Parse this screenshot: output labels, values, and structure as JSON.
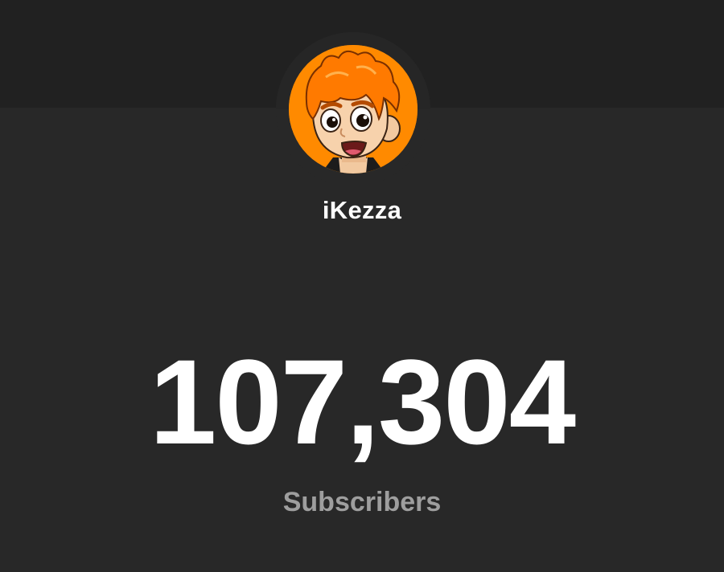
{
  "channel": {
    "name": "iKezza",
    "avatar_icon": "cartoon-avatar-orange-hair",
    "avatar_background": "#ff8a00"
  },
  "stats": {
    "subscriber_count": "107,304",
    "subscriber_label": "Subscribers"
  },
  "theme": {
    "background": "#282828",
    "header_band": "#212121",
    "primary_text": "#ffffff",
    "secondary_text": "#9e9e9e"
  }
}
